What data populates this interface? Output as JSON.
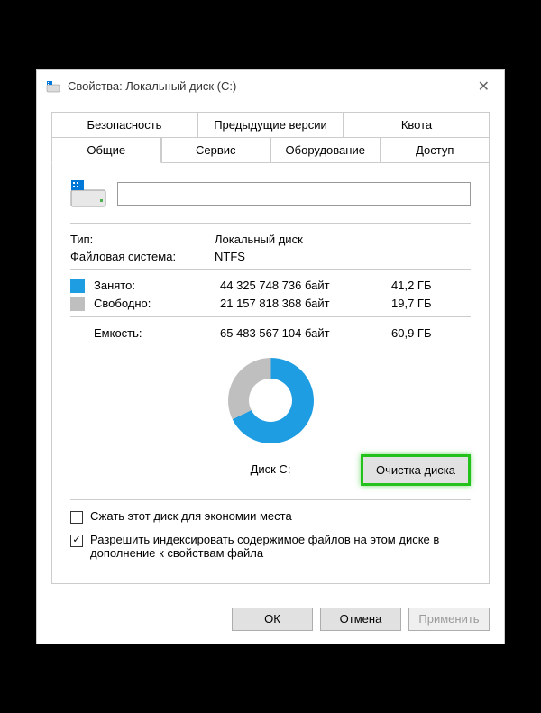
{
  "window": {
    "title": "Свойства: Локальный диск (C:)"
  },
  "tabs_row1": [
    {
      "label": "Безопасность"
    },
    {
      "label": "Предыдущие версии"
    },
    {
      "label": "Квота"
    }
  ],
  "tabs_row2": [
    {
      "label": "Общие",
      "active": true
    },
    {
      "label": "Сервис"
    },
    {
      "label": "Оборудование"
    },
    {
      "label": "Доступ"
    }
  ],
  "name_input": {
    "value": ""
  },
  "type": {
    "label": "Тип:",
    "value": "Локальный диск"
  },
  "filesystem": {
    "label": "Файловая система:",
    "value": "NTFS"
  },
  "used": {
    "label": "Занято:",
    "bytes": "44 325 748 736 байт",
    "gb": "41,2 ГБ"
  },
  "free": {
    "label": "Свободно:",
    "bytes": "21 157 818 368 байт",
    "gb": "19,7 ГБ"
  },
  "capacity": {
    "label": "Емкость:",
    "bytes": "65 483 567 104 байт",
    "gb": "60,9 ГБ"
  },
  "disk_label": "Диск C:",
  "cleanup_button": "Очистка диска",
  "compress_checkbox": {
    "checked": false,
    "label": "Сжать этот диск для экономии места"
  },
  "index_checkbox": {
    "checked": true,
    "label": "Разрешить индексировать содержимое файлов на этом диске в дополнение к свойствам файла"
  },
  "buttons": {
    "ok": "ОК",
    "cancel": "Отмена",
    "apply": "Применить"
  },
  "chart_data": {
    "type": "pie",
    "title": "Диск C:",
    "series": [
      {
        "name": "Занято",
        "value": 44325748736,
        "color": "#1e9de3"
      },
      {
        "name": "Свободно",
        "value": 21157818368,
        "color": "#bfbfbf"
      }
    ],
    "total": 65483567104,
    "unit": "байт"
  }
}
